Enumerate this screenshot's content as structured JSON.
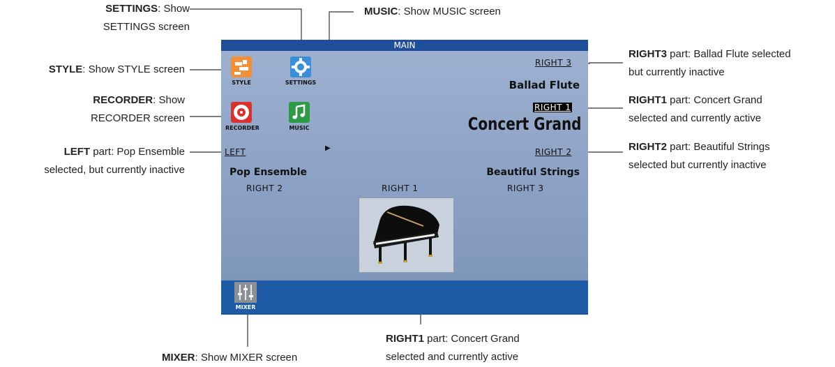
{
  "screen": {
    "title": "MAIN",
    "icons": {
      "style": "STYLE",
      "settings": "SETTINGS",
      "recorder": "RECORDER",
      "music": "MUSIC",
      "mixer": "MIXER"
    },
    "parts": {
      "right3_label": "RIGHT 3",
      "right3_voice": "Ballad Flute",
      "right1_label": "RIGHT 1",
      "right1_voice": "Concert Grand",
      "right2_label": "RIGHT 2",
      "right2_voice": "Beautiful Strings",
      "left_label": "LEFT",
      "left_voice": "Pop Ensemble"
    },
    "sub_labels": {
      "below_left": "RIGHT 2",
      "center": "RIGHT 1",
      "below_right": "RIGHT 3"
    },
    "arrow": "▶"
  },
  "annotations": {
    "settings": {
      "bold": "SETTINGS",
      "line1": ": Show",
      "line2": "SETTINGS screen"
    },
    "music": {
      "bold": "MUSIC",
      "text": ": Show MUSIC screen"
    },
    "style": {
      "bold": "STYLE",
      "text": ": Show STYLE screen"
    },
    "recorder": {
      "bold": "RECORDER",
      "line1": ": Show",
      "line2": "RECORDER screen"
    },
    "left": {
      "bold": "LEFT",
      "line1": " part: Pop Ensemble",
      "line2": "selected, but currently inactive"
    },
    "right3": {
      "bold": "RIGHT3",
      "line1": " part: Ballad Flute selected",
      "line2": "but currently inactive"
    },
    "right1": {
      "bold": "RIGHT1",
      "line1": " part: Concert Grand",
      "line2": "selected and currently active"
    },
    "right2": {
      "bold": "RIGHT2",
      "line1": " part: Beautiful Strings",
      "line2": "selected but currently inactive"
    },
    "mixer": {
      "bold": "MIXER",
      "text": ": Show MIXER screen"
    },
    "right1_bottom": {
      "bold": "RIGHT1",
      "line1": " part: Concert Grand",
      "line2": "selected and currently active"
    }
  },
  "colors": {
    "title_bar": "#1f4f9a",
    "style_icon": "#f0913a",
    "settings_icon": "#3a8fd8",
    "recorder_icon": "#d9322e",
    "music_icon": "#2e9a46",
    "mixer_icon": "#8a8f98"
  }
}
